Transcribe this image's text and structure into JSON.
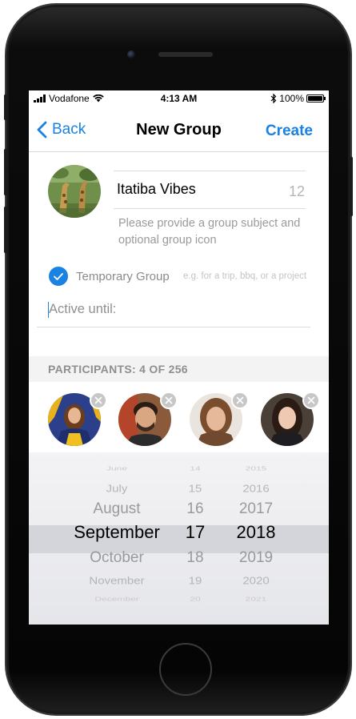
{
  "status_bar": {
    "carrier": "Vodafone",
    "time": "4:13 AM",
    "battery": "100%",
    "battery_level": 1.0
  },
  "nav": {
    "back_label": "Back",
    "title": "New Group",
    "create_label": "Create"
  },
  "group": {
    "subject": "Itatiba Vibes",
    "char_remaining": "12",
    "hint": "Please provide a group subject and optional group icon"
  },
  "temporary": {
    "label": "Temporary Group",
    "hint": "e.g. for a trip, bbq, or a project",
    "checked": true
  },
  "active_until": {
    "placeholder": "Active until:"
  },
  "participants": {
    "header": "PARTICIPANTS: 4 OF 256"
  },
  "picker": {
    "months": [
      "June",
      "July",
      "August",
      "September",
      "October",
      "November",
      "December"
    ],
    "days": [
      "14",
      "15",
      "16",
      "17",
      "18",
      "19",
      "20"
    ],
    "years": [
      "2015",
      "2016",
      "2017",
      "2018",
      "2019",
      "2020",
      "2021"
    ],
    "selected": {
      "month": "September",
      "day": "17",
      "year": "2018"
    }
  },
  "colors": {
    "accent": "#1a82e2",
    "separator": "#dcdcdc",
    "picker_band": "#d4d5da"
  }
}
